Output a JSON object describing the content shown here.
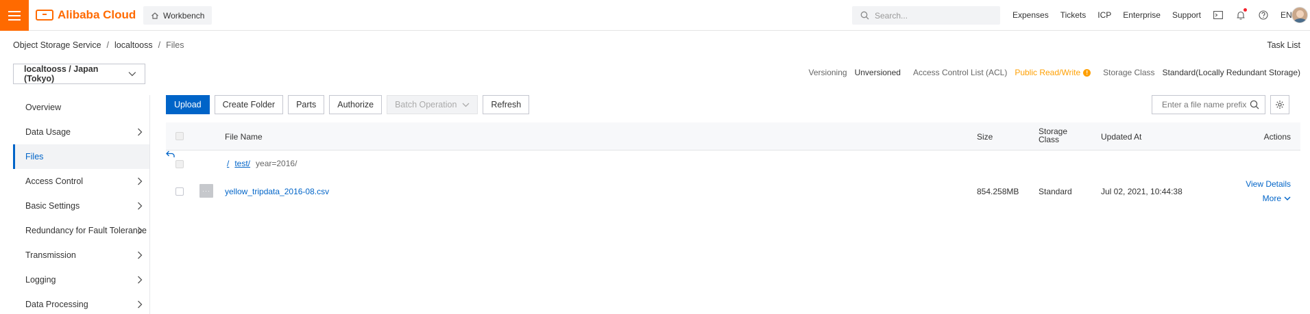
{
  "header": {
    "brand": "Alibaba Cloud",
    "workbench": "Workbench",
    "search_placeholder": "Search...",
    "nav": [
      "Expenses",
      "Tickets",
      "ICP",
      "Enterprise",
      "Support"
    ],
    "language": "EN",
    "icons": [
      "terminal-icon",
      "bell-icon",
      "help-icon"
    ]
  },
  "breadcrumb": {
    "items": [
      "Object Storage Service",
      "localtooss",
      "Files"
    ],
    "separator": "/"
  },
  "task_list": "Task List",
  "bucket_selector": "localtooss / Japan (Tokyo)",
  "bucket_info": {
    "versioning_label": "Versioning",
    "versioning_value": "Unversioned",
    "acl_label": "Access Control List (ACL)",
    "acl_value": "Public Read/Write",
    "storage_class_label": "Storage Class",
    "storage_class_value": "Standard(Locally Redundant Storage)"
  },
  "sidebar": {
    "items": [
      {
        "label": "Overview",
        "has_arrow": false
      },
      {
        "label": "Data Usage",
        "has_arrow": true
      },
      {
        "label": "Files",
        "has_arrow": false,
        "active": true
      },
      {
        "label": "Access Control",
        "has_arrow": true
      },
      {
        "label": "Basic Settings",
        "has_arrow": true
      },
      {
        "label": "Redundancy for Fault Tolerance",
        "has_arrow": true
      },
      {
        "label": "Transmission",
        "has_arrow": true
      },
      {
        "label": "Logging",
        "has_arrow": true
      },
      {
        "label": "Data Processing",
        "has_arrow": true
      }
    ]
  },
  "toolbar": {
    "upload": "Upload",
    "create_folder": "Create Folder",
    "parts": "Parts",
    "authorize": "Authorize",
    "batch_operation": "Batch Operation",
    "refresh": "Refresh",
    "file_search_placeholder": "Enter a file name prefix"
  },
  "table": {
    "columns": {
      "name": "File Name",
      "size": "Size",
      "storage_class": "Storage Class",
      "updated_at": "Updated At",
      "actions": "Actions"
    },
    "path": {
      "root": "/",
      "folder": "test/",
      "current": "year=2016/"
    },
    "rows": [
      {
        "name": "yellow_tripdata_2016-08.csv",
        "size": "854.258MB",
        "storage_class": "Standard",
        "updated_at": "Jul 02, 2021, 10:44:38",
        "action_primary": "View Details",
        "action_more": "More"
      }
    ]
  },
  "colors": {
    "brand_orange": "#ff6a00",
    "primary_blue": "#0064c8",
    "warning": "#ffa003"
  }
}
